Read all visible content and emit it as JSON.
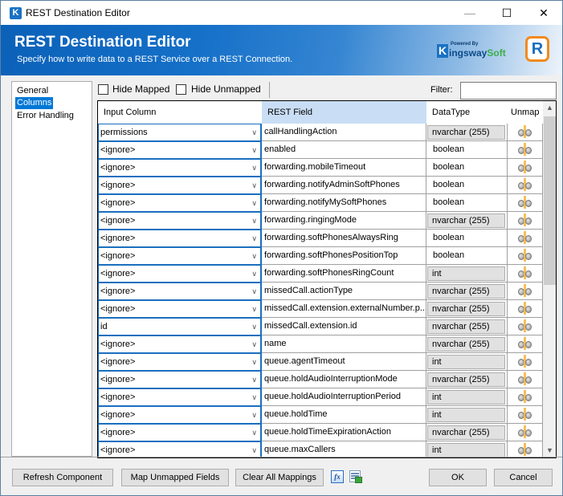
{
  "window": {
    "title": "REST Destination Editor",
    "controls": {
      "minimize": "—",
      "maximize": "☐",
      "close": "✕"
    }
  },
  "banner": {
    "title": "REST Destination Editor",
    "subtitle": "Specify how to write data to a REST Service over a REST Connection.",
    "vendor": {
      "powered_by": "Powered By",
      "k": "K",
      "name_main": "ingsway",
      "name_soft": "Soft"
    },
    "product_logo": "R"
  },
  "nav": {
    "items": [
      {
        "label": "General",
        "selected": false
      },
      {
        "label": "Columns",
        "selected": true
      },
      {
        "label": "Error Handling",
        "selected": false
      }
    ]
  },
  "toolbar": {
    "hide_mapped": {
      "label": "Hide Mapped",
      "checked": false
    },
    "hide_unmapped": {
      "label": "Hide Unmapped",
      "checked": false
    },
    "filter_label": "Filter:",
    "filter_value": ""
  },
  "grid": {
    "headers": {
      "input_column": "Input Column",
      "rest_field": "REST Field",
      "data_type": "DataType",
      "unmap": "Unmap"
    },
    "rows": [
      {
        "input": "permissions",
        "field": "callHandlingAction",
        "type": "nvarchar (255)",
        "type_boxed": true
      },
      {
        "input": "<ignore>",
        "field": "enabled",
        "type": "boolean",
        "type_boxed": false
      },
      {
        "input": "<ignore>",
        "field": "forwarding.mobileTimeout",
        "type": "boolean",
        "type_boxed": false
      },
      {
        "input": "<ignore>",
        "field": "forwarding.notifyAdminSoftPhones",
        "type": "boolean",
        "type_boxed": false
      },
      {
        "input": "<ignore>",
        "field": "forwarding.notifyMySoftPhones",
        "type": "boolean",
        "type_boxed": false
      },
      {
        "input": "<ignore>",
        "field": "forwarding.ringingMode",
        "type": "nvarchar (255)",
        "type_boxed": true
      },
      {
        "input": "<ignore>",
        "field": "forwarding.softPhonesAlwaysRing",
        "type": "boolean",
        "type_boxed": false
      },
      {
        "input": "<ignore>",
        "field": "forwarding.softPhonesPositionTop",
        "type": "boolean",
        "type_boxed": false
      },
      {
        "input": "<ignore>",
        "field": "forwarding.softPhonesRingCount",
        "type": "int",
        "type_boxed": true
      },
      {
        "input": "<ignore>",
        "field": "missedCall.actionType",
        "type": "nvarchar (255)",
        "type_boxed": true
      },
      {
        "input": "<ignore>",
        "field": "missedCall.extension.externalNumber.p...",
        "type": "nvarchar (255)",
        "type_boxed": true
      },
      {
        "input": "id",
        "field": "missedCall.extension.id",
        "type": "nvarchar (255)",
        "type_boxed": true
      },
      {
        "input": "<ignore>",
        "field": "name",
        "type": "nvarchar (255)",
        "type_boxed": true
      },
      {
        "input": "<ignore>",
        "field": "queue.agentTimeout",
        "type": "int",
        "type_boxed": true
      },
      {
        "input": "<ignore>",
        "field": "queue.holdAudioInterruptionMode",
        "type": "nvarchar (255)",
        "type_boxed": true
      },
      {
        "input": "<ignore>",
        "field": "queue.holdAudioInterruptionPeriod",
        "type": "int",
        "type_boxed": true
      },
      {
        "input": "<ignore>",
        "field": "queue.holdTime",
        "type": "int",
        "type_boxed": true
      },
      {
        "input": "<ignore>",
        "field": "queue.holdTimeExpirationAction",
        "type": "nvarchar (255)",
        "type_boxed": true
      },
      {
        "input": "<ignore>",
        "field": "queue.maxCallers",
        "type": "int",
        "type_boxed": true
      }
    ]
  },
  "footer": {
    "refresh_component": "Refresh Component",
    "map_unmapped": "Map Unmapped Fields",
    "clear_all": "Clear All Mappings",
    "fx_label": "fx",
    "ok": "OK",
    "cancel": "Cancel"
  }
}
